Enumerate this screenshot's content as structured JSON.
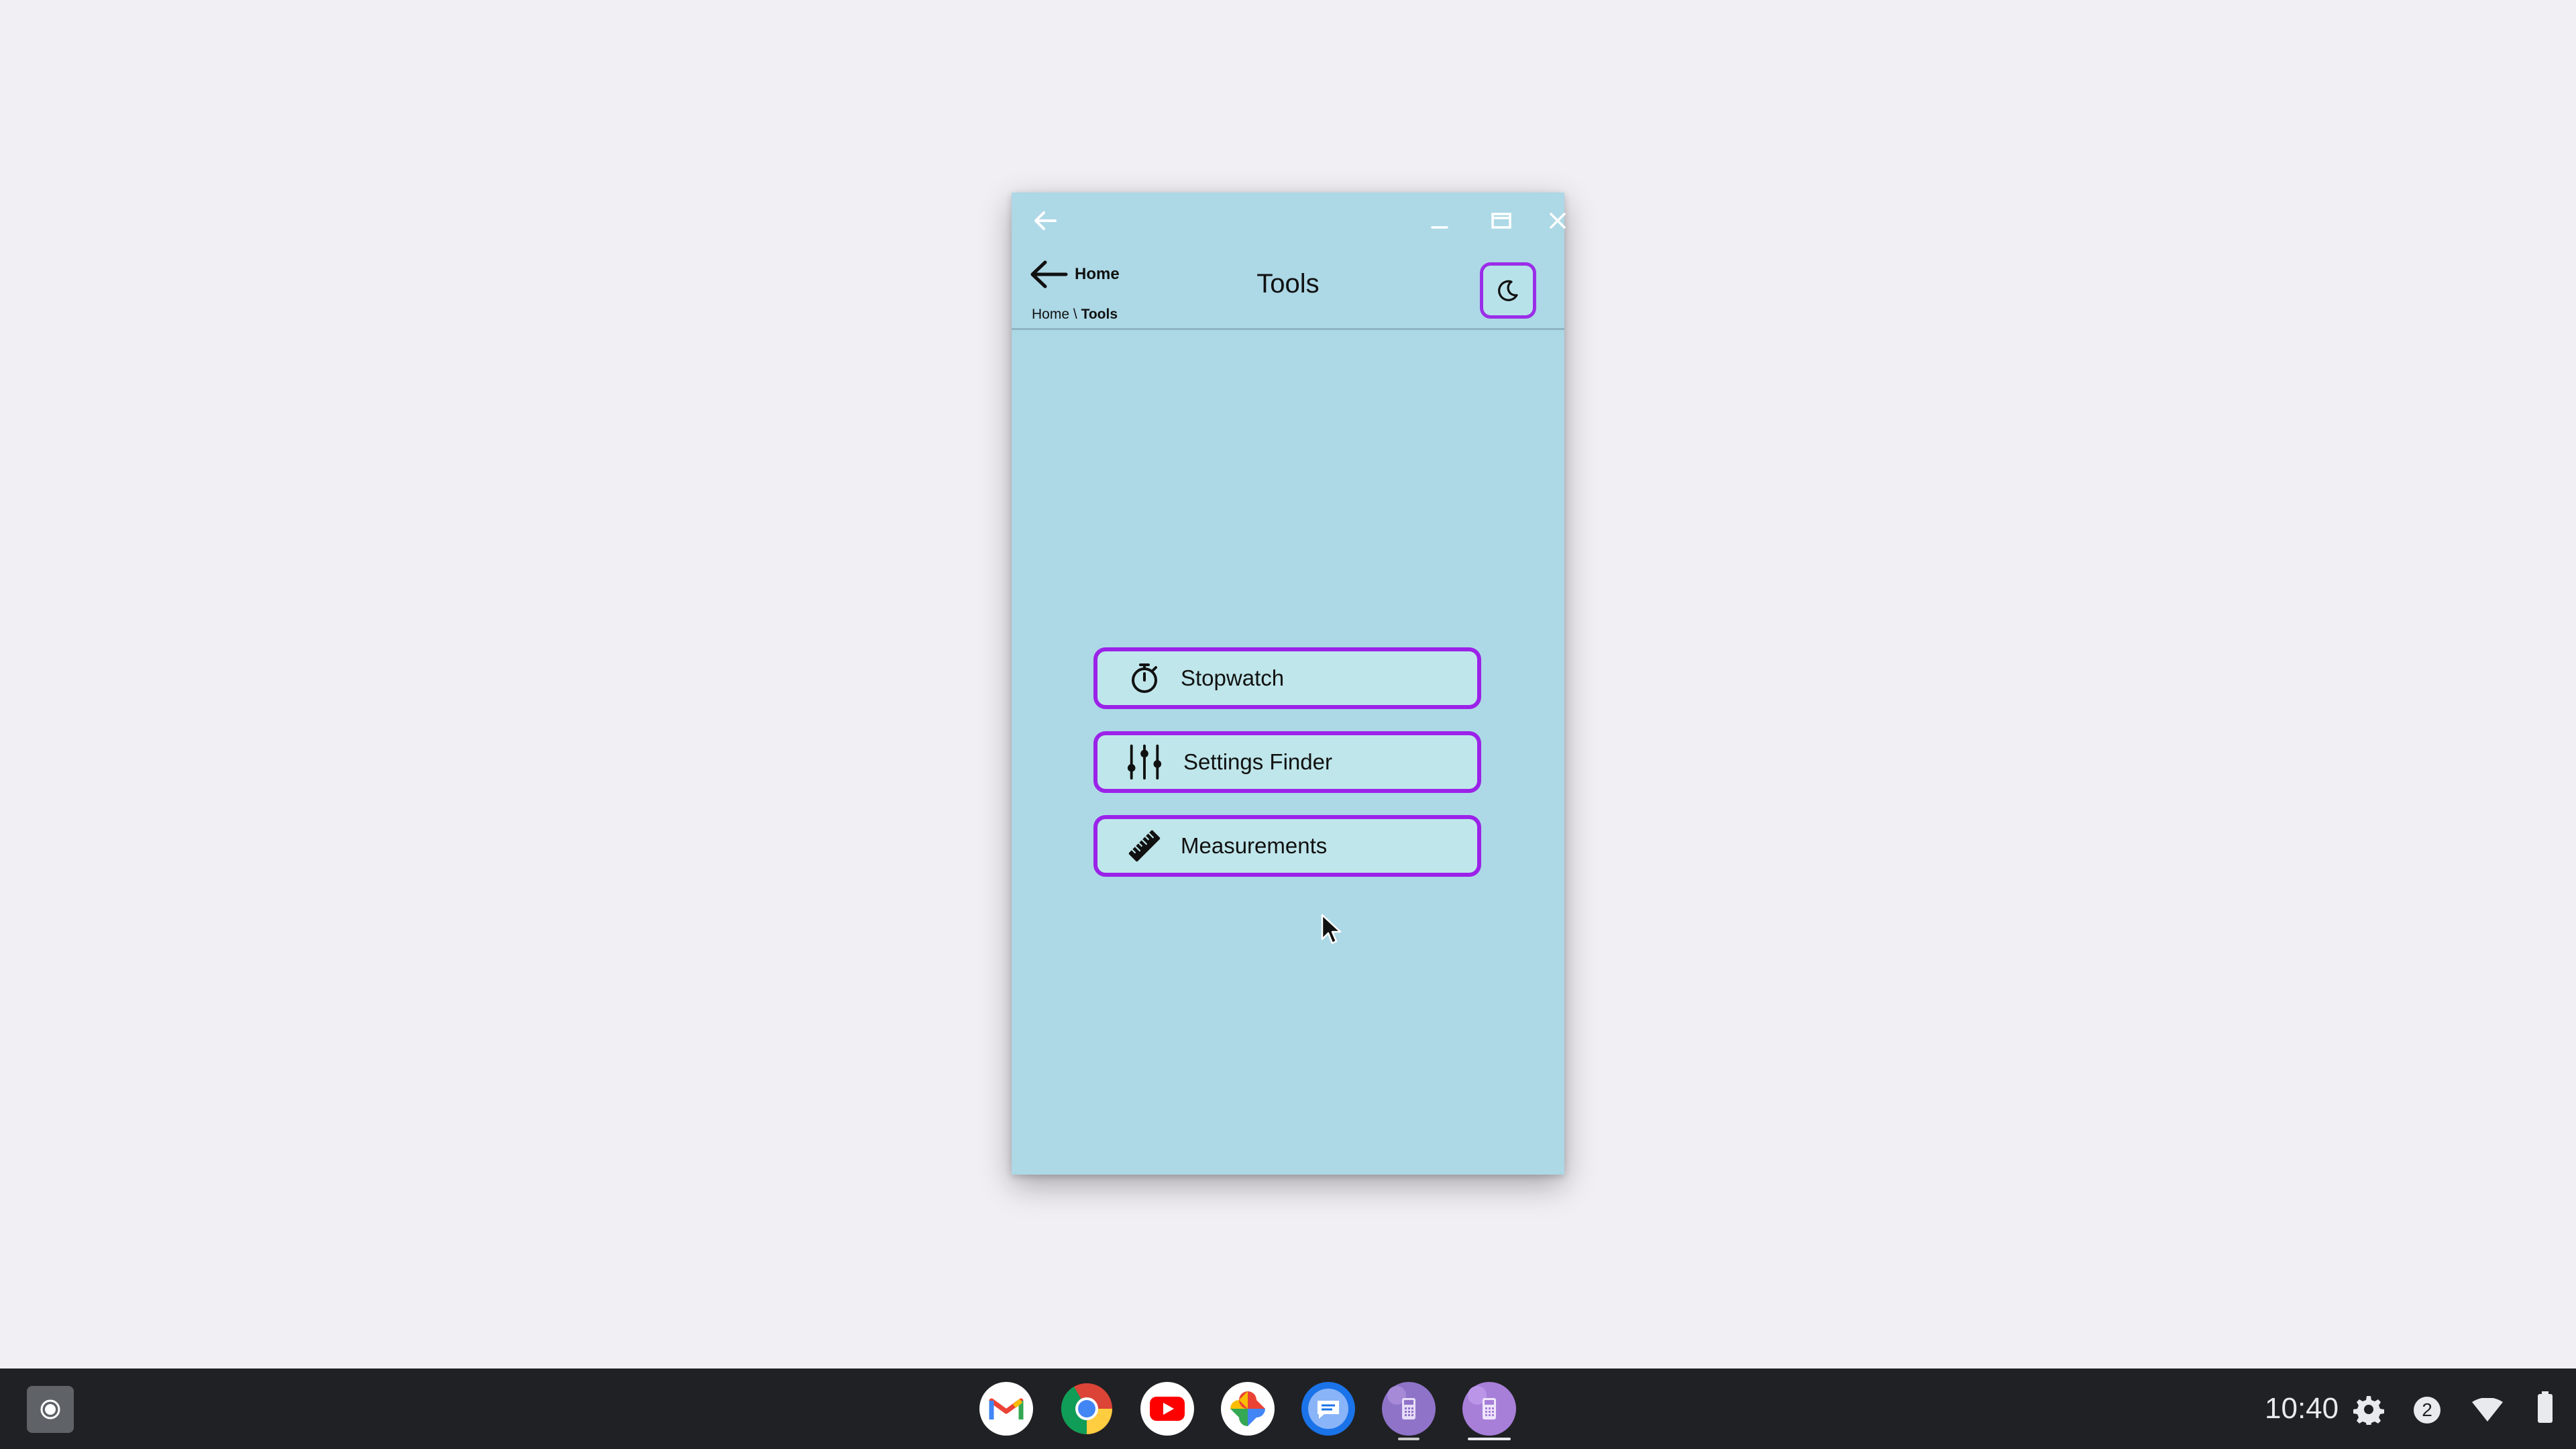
{
  "window": {
    "app_header": {
      "back_label": "Home",
      "title": "Tools",
      "breadcrumb": {
        "parent": "Home",
        "separator": "\\",
        "current": "Tools"
      }
    },
    "tools": [
      {
        "label": "Stopwatch",
        "icon": "stopwatch-icon"
      },
      {
        "label": "Settings Finder",
        "icon": "sliders-icon"
      },
      {
        "label": "Measurements",
        "icon": "ruler-icon"
      }
    ],
    "theme_toggle_icon": "moon-icon"
  },
  "colors": {
    "window_background": "#add8e6",
    "accent_border": "#9b22e8",
    "button_fill": "#bfe6ea",
    "desktop_background": "#f1eff4",
    "shelf_background": "#202124"
  },
  "shelf": {
    "apps": [
      "Gmail",
      "Chrome",
      "YouTube",
      "Google Photos",
      "Messages",
      "Calculator",
      "Calculator"
    ],
    "clock": "10:40",
    "notification_count": "2",
    "tray_icons": [
      "gear-icon",
      "wifi-icon",
      "battery-icon"
    ]
  }
}
